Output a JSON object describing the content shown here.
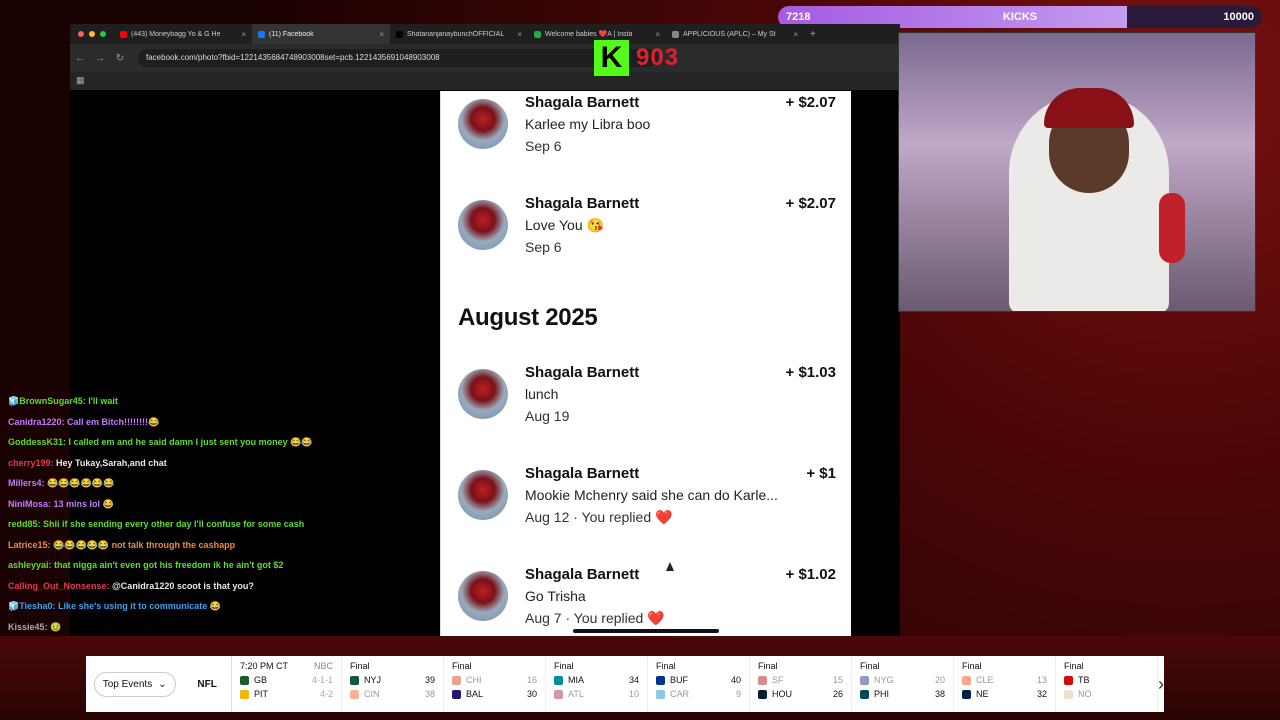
{
  "browser": {
    "tabs": [
      {
        "title": "(443) Moneybagg Yo & G He",
        "color": "#ff0000"
      },
      {
        "title": "(11) Facebook",
        "color": "#1877f2",
        "active": true
      },
      {
        "title": "ShatarianjanaybunchOFFICIAL",
        "color": "#000000"
      },
      {
        "title": "Welcome babies ❤️A | Insta",
        "color": "#22aa44"
      },
      {
        "title": "APPLICIOUS (APLC) – My St",
        "color": "#888888"
      }
    ],
    "url": "facebook.com/photo?fbid=1221435684748903008set=pcb.1221435691048903008"
  },
  "overlay": {
    "kicks_left": "7218",
    "kicks_label": "KICKS",
    "kicks_right": "10000",
    "kicks_progress": 0.7218,
    "kick_logo": "K",
    "kick_count": "903"
  },
  "fb": {
    "transactions_top": [
      {
        "name": "Shagala Barnett",
        "message": "Karlee my Libra boo",
        "date": "Sep 6",
        "amount": "+ $2.07"
      },
      {
        "name": "Shagala Barnett",
        "message": "Love You 😘",
        "date": "Sep 6",
        "amount": "+ $2.07"
      }
    ],
    "month": "August 2025",
    "transactions_bottom": [
      {
        "name": "Shagala Barnett",
        "message": "lunch",
        "date": "Aug 19",
        "amount": "+ $1.03"
      },
      {
        "name": "Shagala Barnett",
        "message": "Mookie Mchenry said she can do Karle...",
        "date": "Aug 12 · You replied",
        "amount": "+ $1",
        "heart": "❤️"
      },
      {
        "name": "Shagala Barnett",
        "message": "Go Trisha",
        "date": "Aug 7 · You replied",
        "amount": "+ $1.02",
        "heart": "❤️"
      }
    ]
  },
  "chat": [
    {
      "user": "🧊BrownSugar45:",
      "msg": "I'll wait",
      "color": "#5fdc2f"
    },
    {
      "user": "Canidra1220:",
      "msg": "Call em Bitch!!!!!!!!😂",
      "color": "#c27bff"
    },
    {
      "user": "GoddessK31:",
      "msg": "I called em and he said damn I just sent you money 😂😂",
      "color": "#5fdc2f"
    },
    {
      "user": "cherry199:",
      "msg": "Hey Tukay,Sarah,and chat",
      "color": "#e03a52"
    },
    {
      "user": "Millers4:",
      "msg": "😂😂😂😂😂😂",
      "color": "#c27bff"
    },
    {
      "user": "NiniMosa:",
      "msg": "13 mins lol 😂",
      "color": "#c27bff"
    },
    {
      "user": "redd85:",
      "msg": "Shii if she sending every other day I'll confuse for some cash",
      "color": "#5fdc2f"
    },
    {
      "user": "Latrice15:",
      "msg": "😂😂😂😂😂 not talk through the cashapp",
      "color": "#f08a3a"
    },
    {
      "user": "ashleyyai:",
      "msg": "that nigga ain't even got his freedom ik he ain't got $2",
      "color": "#5fdc2f"
    },
    {
      "user": "Calling_Out_Nonsense:",
      "msg": "@Canidra1220 scoot is that you?",
      "color": "#e03a52"
    },
    {
      "user": "🧊Tiesha0:",
      "msg": "Like she's using it to communicate 😂",
      "color": "#3aa0f0"
    },
    {
      "user": "Kissie45:",
      "msg": "🤢",
      "color": "#aaaaaa"
    }
  ],
  "ticker": {
    "selector": "Top Events",
    "league": "NFL",
    "games": [
      {
        "status": "7:20 PM CT",
        "network": "NBC",
        "a": "GB",
        "as": "",
        "ar": "4-1-1",
        "b": "PIT",
        "bs": "",
        "br": "4-2",
        "ca": "#1f5b2a",
        "cb": "#f2b600"
      },
      {
        "status": "Final",
        "a": "NYJ",
        "as": "39",
        "b": "CIN",
        "bs": "38",
        "ca": "#125740",
        "cb": "#fb4f14",
        "lose": "b"
      },
      {
        "status": "Final",
        "a": "CHI",
        "as": "16",
        "b": "BAL",
        "bs": "30",
        "ca": "#c83803",
        "cb": "#241773",
        "lose": "a"
      },
      {
        "status": "Final",
        "a": "MIA",
        "as": "34",
        "b": "ATL",
        "bs": "10",
        "ca": "#008e97",
        "cb": "#a71930",
        "lose": "b"
      },
      {
        "status": "Final",
        "a": "BUF",
        "as": "40",
        "b": "CAR",
        "bs": "9",
        "ca": "#00338d",
        "cb": "#0085ca",
        "lose": "b"
      },
      {
        "status": "Final",
        "a": "SF",
        "as": "15",
        "b": "HOU",
        "bs": "26",
        "ca": "#aa0000",
        "cb": "#03202f",
        "lose": "a"
      },
      {
        "status": "Final",
        "a": "NYG",
        "as": "20",
        "b": "PHI",
        "bs": "38",
        "ca": "#0b2265",
        "cb": "#004c54",
        "lose": "a"
      },
      {
        "status": "Final",
        "a": "CLE",
        "as": "13",
        "b": "NE",
        "bs": "32",
        "ca": "#ff3c00",
        "cb": "#002244",
        "lose": "a"
      },
      {
        "status": "Final",
        "a": "TB",
        "as": "",
        "b": "NO",
        "bs": "",
        "ca": "#d50a0a",
        "cb": "#d3bc8d",
        "lose": "b"
      }
    ]
  }
}
